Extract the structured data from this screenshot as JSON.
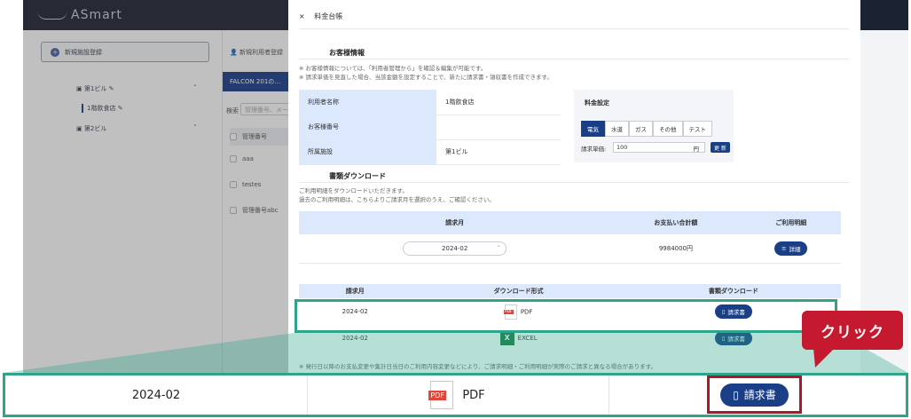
{
  "app": {
    "logo_text": "ASmart"
  },
  "left_panel": {
    "new_facility_button": "新規施設登録",
    "tree": [
      {
        "label": "第1ビル",
        "expanded": true
      },
      {
        "label": "1階飲食店",
        "child": true
      },
      {
        "label": "第2ビル",
        "expanded": false
      }
    ]
  },
  "middle_panel": {
    "new_user_button": "新規利用者登録",
    "banner": "FALCON 201の…",
    "search_label": "検索",
    "search_placeholder": "管理番号、メー",
    "column_header": "管理番号",
    "rows": [
      "aaa",
      "testes",
      "管理番号abc"
    ]
  },
  "panel": {
    "title": "料金台帳",
    "customer_section_title": "お客様情報",
    "notes": [
      "※ お客様情報については、「利用者管理から」を確認＆編集が可能です。",
      "※ 請求単価を見直した場合、当該金額を設定することで、新たに請求書・領収書を作成できます。"
    ],
    "customer_info": [
      {
        "key": "利用者名称",
        "value": "1階飲食店"
      },
      {
        "key": "お客様番号",
        "value": ""
      },
      {
        "key": "所属施設",
        "value": "第1ビル"
      }
    ],
    "fee_settings": {
      "title": "料金設定",
      "tabs": [
        "電気",
        "水道",
        "ガス",
        "その他",
        "テスト"
      ],
      "unit_label": "請求単価:",
      "unit_value": "100",
      "unit_suffix": "円",
      "update_button": "更 新"
    },
    "download_section_title": "書類ダウンロード",
    "download_notes": [
      "ご利用明細をダウンロードいただきます。",
      "過去のご利用明細は、こちらよりご請求月を選択のうえ、ご確認ください。"
    ],
    "download_table": {
      "headers": [
        "請求月",
        "お支払い合計額",
        "ご利用明細"
      ],
      "month": "2024-02",
      "total": "9984000円",
      "detail_button": "詳細"
    },
    "doc_table": {
      "headers": [
        "請求月",
        "ダウンロード形式",
        "書類ダウンロード"
      ],
      "rows": [
        {
          "month": "2024-02",
          "format": "PDF",
          "button": "請求書"
        },
        {
          "month": "2024-02",
          "format": "EXCEL",
          "button": "請求書"
        }
      ]
    },
    "footer_note": "※ 発行日以降のお支払変更や集計日当日のご利用内容変更などにより、ご請求明細・ご利用明細が実際のご請求と異なる場合があります。"
  },
  "zoom": {
    "month": "2024-02",
    "format": "PDF",
    "button": "請求書",
    "pdf_badge": "PDF"
  },
  "callout": {
    "text": "クリック"
  },
  "colors": {
    "navy": "#1b3f86",
    "teal": "#2ea58a",
    "red": "#c4192e"
  }
}
